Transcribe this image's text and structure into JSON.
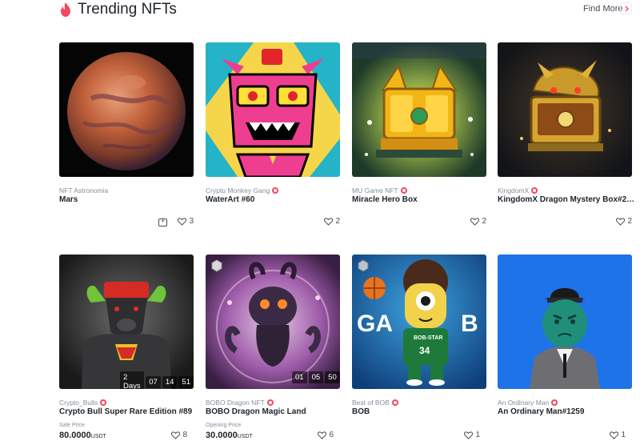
{
  "header": {
    "title": "Trending NFTs",
    "find_more": "Find More",
    "accent_color": "#f6465d"
  },
  "cards": [
    {
      "collection": "NFT Astronomia",
      "name": "Mars",
      "likes": "3",
      "verified": false,
      "has_folder": true
    },
    {
      "collection": "Crypto Monkey Gang",
      "name": "WaterArt #60",
      "likes": "2",
      "verified": true
    },
    {
      "collection": "MU Game NFT",
      "name": "Miracle Hero Box",
      "likes": "2",
      "verified": true
    },
    {
      "collection": "KingdomX",
      "name": "KingdomX Dragon Mystery Box#2070...",
      "likes": "2",
      "verified": true
    },
    {
      "collection": "Crypto_Bulls",
      "name": "Crypto Bull Super Rare Edition #89",
      "likes": "8",
      "verified": true,
      "price_label": "Sale Price",
      "price": "80.0000",
      "unit": "USDT",
      "countdown": [
        "2 Days",
        "07",
        "14",
        "51"
      ]
    },
    {
      "collection": "BOBO Dragon NFT",
      "name": "BOBO Dragon Magic Land",
      "likes": "6",
      "verified": true,
      "price_label": "Opening Price",
      "price": "30.0000",
      "unit": "USDT",
      "countdown": [
        "01",
        "05",
        "50"
      ]
    },
    {
      "collection": "Best of BOB",
      "name": "BOB",
      "likes": "1",
      "verified": true
    },
    {
      "collection": "An Ordinary Man",
      "name": "An Ordinary Man#1259",
      "likes": "1",
      "verified": true
    }
  ]
}
